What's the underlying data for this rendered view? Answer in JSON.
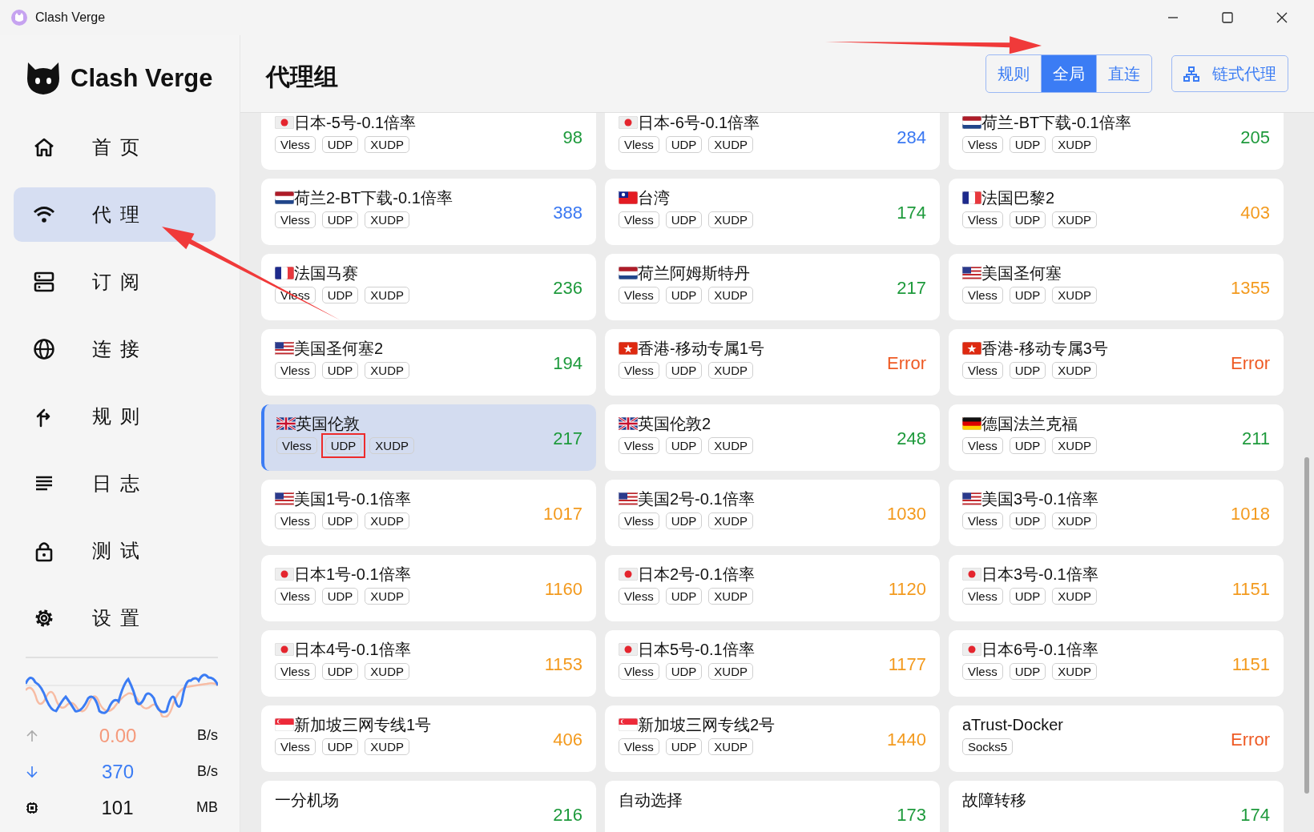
{
  "window": {
    "title": "Clash Verge"
  },
  "sidebar": {
    "logo": "Clash Verge",
    "items": [
      {
        "label": "首页",
        "selected": false
      },
      {
        "label": "代理",
        "selected": true
      },
      {
        "label": "订阅",
        "selected": false
      },
      {
        "label": "连接",
        "selected": false
      },
      {
        "label": "规则",
        "selected": false
      },
      {
        "label": "日志",
        "selected": false
      },
      {
        "label": "测试",
        "selected": false
      },
      {
        "label": "设置",
        "selected": false
      }
    ],
    "traffic": [
      {
        "kind": "up",
        "value": "0.00",
        "unit": "B/s"
      },
      {
        "kind": "down",
        "value": "370",
        "unit": "B/s"
      },
      {
        "kind": "memory",
        "value": "101",
        "unit": "MB"
      }
    ]
  },
  "header": {
    "title": "代理组",
    "modes": [
      {
        "label": "规则",
        "selected": false
      },
      {
        "label": "全局",
        "selected": true
      },
      {
        "label": "直连",
        "selected": false
      }
    ],
    "chain_button": "链式代理"
  },
  "proxies": [
    {
      "name": "日本-5号-0.1倍率",
      "kind": "japan",
      "tags": [
        "Vless",
        "UDP",
        "XUDP"
      ],
      "delay": "98",
      "color": "#1e9a3c",
      "selected": false
    },
    {
      "name": "日本-6号-0.1倍率",
      "kind": "japan",
      "tags": [
        "Vless",
        "UDP",
        "XUDP"
      ],
      "delay": "284",
      "color": "#3a78f2",
      "selected": false
    },
    {
      "name": "荷兰-BT下载-0.1倍率",
      "kind": "netherlands",
      "tags": [
        "Vless",
        "UDP",
        "XUDP"
      ],
      "delay": "205",
      "color": "#1e9a3c",
      "selected": false
    },
    {
      "name": "荷兰2-BT下载-0.1倍率",
      "kind": "netherlands",
      "tags": [
        "Vless",
        "UDP",
        "XUDP"
      ],
      "delay": "388",
      "color": "#3a78f2",
      "selected": false
    },
    {
      "name": "台湾",
      "kind": "taiwan",
      "tags": [
        "Vless",
        "UDP",
        "XUDP"
      ],
      "delay": "174",
      "color": "#1e9a3c",
      "selected": false
    },
    {
      "name": "法国巴黎2",
      "kind": "france",
      "tags": [
        "Vless",
        "UDP",
        "XUDP"
      ],
      "delay": "403",
      "color": "#f39a1e",
      "selected": false
    },
    {
      "name": "法国马赛",
      "kind": "france",
      "tags": [
        "Vless",
        "UDP",
        "XUDP"
      ],
      "delay": "236",
      "color": "#1e9a3c",
      "selected": false
    },
    {
      "name": "荷兰阿姆斯特丹",
      "kind": "netherlands",
      "tags": [
        "Vless",
        "UDP",
        "XUDP"
      ],
      "delay": "217",
      "color": "#1e9a3c",
      "selected": false
    },
    {
      "name": "美国圣何塞",
      "kind": "usa",
      "tags": [
        "Vless",
        "UDP",
        "XUDP"
      ],
      "delay": "1355",
      "color": "#f39a1e",
      "selected": false
    },
    {
      "name": "美国圣何塞2",
      "kind": "usa",
      "tags": [
        "Vless",
        "UDP",
        "XUDP"
      ],
      "delay": "194",
      "color": "#1e9a3c",
      "selected": false
    },
    {
      "name": "香港-移动专属1号",
      "kind": "hongkong",
      "tags": [
        "Vless",
        "UDP",
        "XUDP"
      ],
      "delay": "Error",
      "color": "#ee5a24",
      "selected": false
    },
    {
      "name": "香港-移动专属3号",
      "kind": "hongkong",
      "tags": [
        "Vless",
        "UDP",
        "XUDP"
      ],
      "delay": "Error",
      "color": "#ee5a24",
      "selected": false
    },
    {
      "name": "英国伦敦",
      "kind": "britain",
      "tags": [
        "Vless",
        {
          "label": "UDP",
          "boxed": true
        },
        "XUDP"
      ],
      "delay": "217",
      "color": "#1e9a3c",
      "selected": true
    },
    {
      "name": "英国伦敦2",
      "kind": "britain",
      "tags": [
        "Vless",
        "UDP",
        "XUDP"
      ],
      "delay": "248",
      "color": "#1e9a3c",
      "selected": false
    },
    {
      "name": "德国法兰克福",
      "kind": "germany",
      "tags": [
        "Vless",
        "UDP",
        "XUDP"
      ],
      "delay": "211",
      "color": "#1e9a3c",
      "selected": false
    },
    {
      "name": "美国1号-0.1倍率",
      "kind": "usa",
      "tags": [
        "Vless",
        "UDP",
        "XUDP"
      ],
      "delay": "1017",
      "color": "#f39a1e",
      "selected": false
    },
    {
      "name": "美国2号-0.1倍率",
      "kind": "usa",
      "tags": [
        "Vless",
        "UDP",
        "XUDP"
      ],
      "delay": "1030",
      "color": "#f39a1e",
      "selected": false
    },
    {
      "name": "美国3号-0.1倍率",
      "kind": "usa",
      "tags": [
        "Vless",
        "UDP",
        "XUDP"
      ],
      "delay": "1018",
      "color": "#f39a1e",
      "selected": false
    },
    {
      "name": "日本1号-0.1倍率",
      "kind": "japan",
      "tags": [
        "Vless",
        "UDP",
        "XUDP"
      ],
      "delay": "1160",
      "color": "#f39a1e",
      "selected": false
    },
    {
      "name": "日本2号-0.1倍率",
      "kind": "japan",
      "tags": [
        "Vless",
        "UDP",
        "XUDP"
      ],
      "delay": "1120",
      "color": "#f39a1e",
      "selected": false
    },
    {
      "name": "日本3号-0.1倍率",
      "kind": "japan",
      "tags": [
        "Vless",
        "UDP",
        "XUDP"
      ],
      "delay": "1151",
      "color": "#f39a1e",
      "selected": false
    },
    {
      "name": "日本4号-0.1倍率",
      "kind": "japan",
      "tags": [
        "Vless",
        "UDP",
        "XUDP"
      ],
      "delay": "1153",
      "color": "#f39a1e",
      "selected": false
    },
    {
      "name": "日本5号-0.1倍率",
      "kind": "japan",
      "tags": [
        "Vless",
        "UDP",
        "XUDP"
      ],
      "delay": "1177",
      "color": "#f39a1e",
      "selected": false
    },
    {
      "name": "日本6号-0.1倍率",
      "kind": "japan",
      "tags": [
        "Vless",
        "UDP",
        "XUDP"
      ],
      "delay": "1151",
      "color": "#f39a1e",
      "selected": false
    },
    {
      "name": "新加坡三网专线1号",
      "kind": "singapore",
      "tags": [
        "Vless",
        "UDP",
        "XUDP"
      ],
      "delay": "406",
      "color": "#f39a1e",
      "selected": false
    },
    {
      "name": "新加坡三网专线2号",
      "kind": "singapore",
      "tags": [
        "Vless",
        "UDP",
        "XUDP"
      ],
      "delay": "1440",
      "color": "#f39a1e",
      "selected": false
    },
    {
      "name": "aTrust-Docker",
      "tags": [
        "Socks5"
      ],
      "delay": "Error",
      "color": "#ee5a24",
      "selected": false
    },
    {
      "name": "一分机场",
      "delay": "216",
      "color": "#1e9a3c",
      "selected": false
    },
    {
      "name": "自动选择",
      "delay": "173",
      "color": "#1e9a3c",
      "selected": false
    },
    {
      "name": "故障转移",
      "delay": "174",
      "color": "#1e9a3c",
      "selected": false
    }
  ],
  "annotations": [
    {
      "kind": "arrow"
    },
    {
      "kind": "arrow"
    }
  ]
}
